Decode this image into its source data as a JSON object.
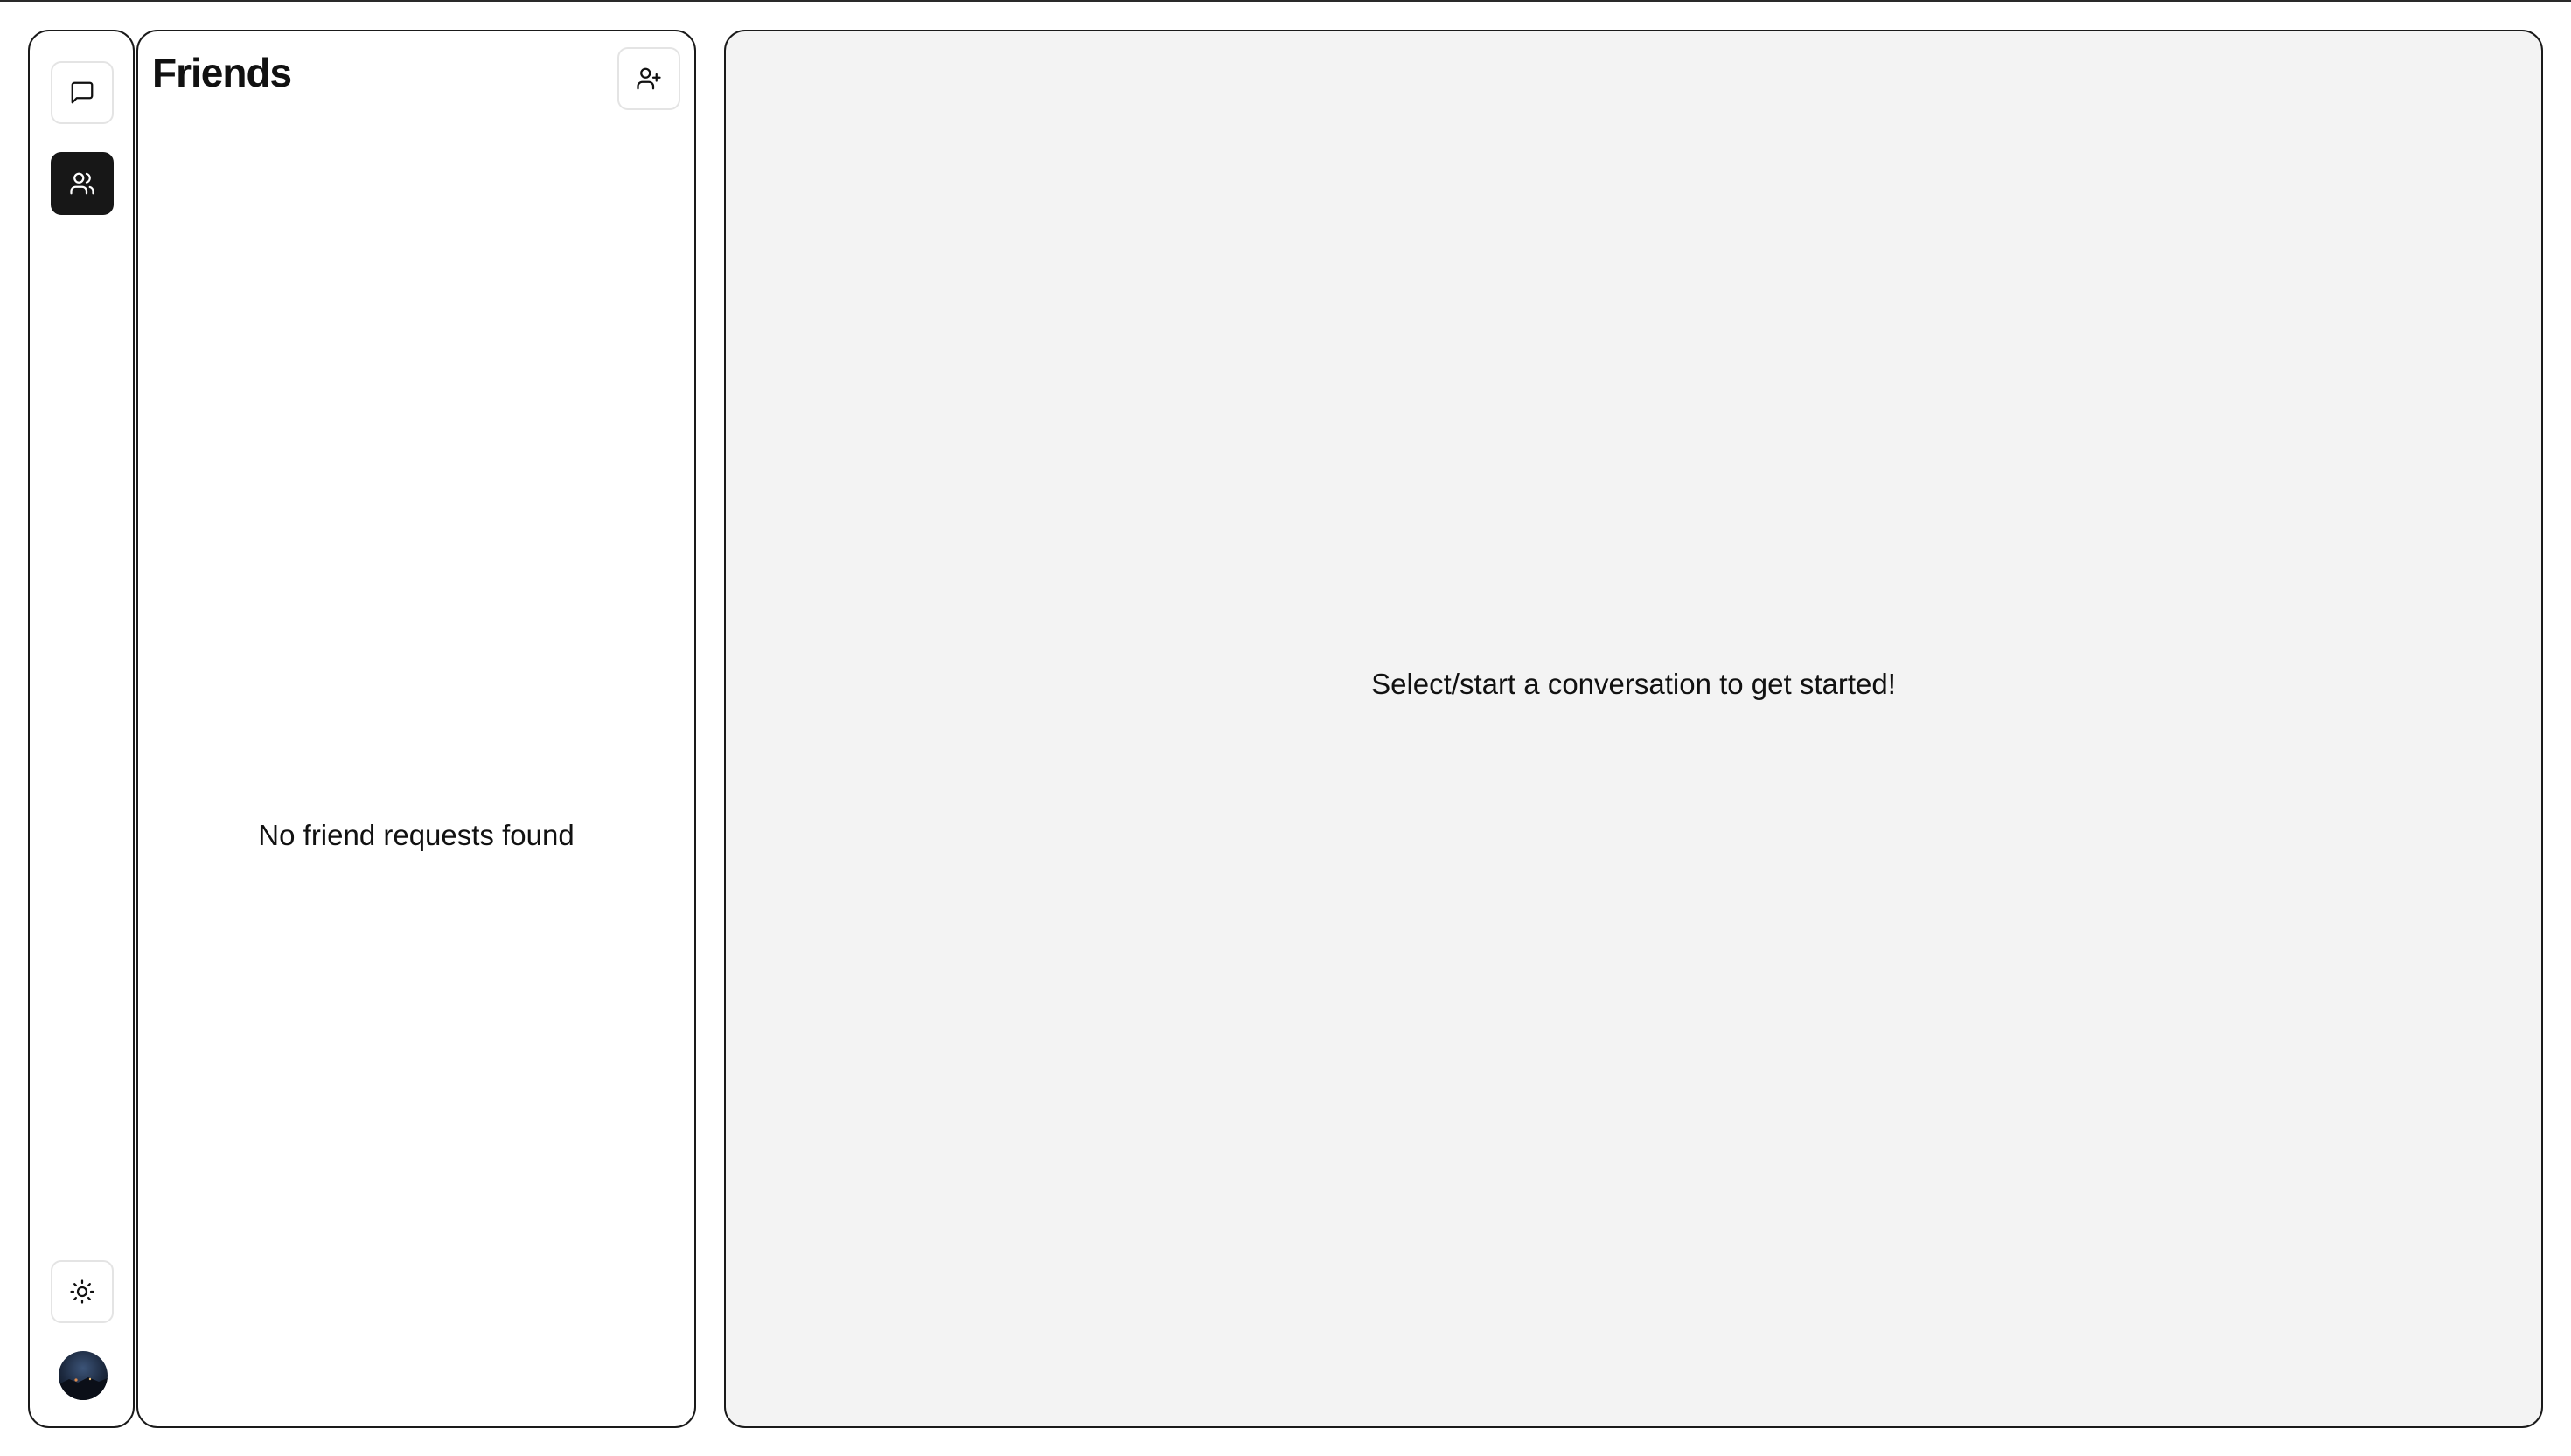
{
  "sidebar": {
    "items": [
      {
        "name": "conversations",
        "icon": "message-square-icon",
        "active": false
      },
      {
        "name": "friends",
        "icon": "users-icon",
        "active": true
      }
    ],
    "theme_toggle_icon": "sun-icon",
    "avatar_icon": "user-avatar"
  },
  "friends": {
    "title": "Friends",
    "add_friend_icon": "user-plus-icon",
    "empty_message": "No friend requests found"
  },
  "conversation": {
    "empty_message": "Select/start a conversation to get started!"
  },
  "colors": {
    "active_bg": "#171717",
    "panel_border": "#1a1a1a",
    "button_border": "#e4e4e4",
    "conversation_bg": "#f3f3f3"
  }
}
